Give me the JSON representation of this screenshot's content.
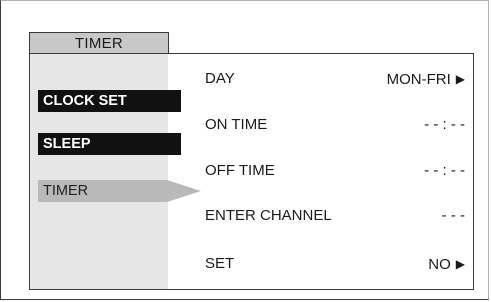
{
  "tab": {
    "label": "TIMER"
  },
  "sidebar": {
    "items": [
      {
        "label": "CLOCK SET"
      },
      {
        "label": "SLEEP"
      },
      {
        "label": "TIMER"
      }
    ]
  },
  "settings": {
    "rows": [
      {
        "label": "DAY",
        "value": "MON-FRI",
        "arrow": "▶"
      },
      {
        "label": "ON TIME",
        "value": "- - : - -"
      },
      {
        "label": "OFF TIME",
        "value": "- - : - -"
      },
      {
        "label": "ENTER CHANNEL",
        "value": "- - -"
      },
      {
        "label": "SET",
        "value": "NO",
        "arrow": "▶"
      }
    ]
  },
  "icons": {
    "pointer": "right-pointer-icon",
    "arrow": "right-triangle-icon"
  },
  "colors": {
    "sidebar_bg": "#e6e6e6",
    "selected_bg": "#b9b9b9",
    "dark_item_bg": "#111111",
    "tab_bg": "#c8c8c8"
  }
}
